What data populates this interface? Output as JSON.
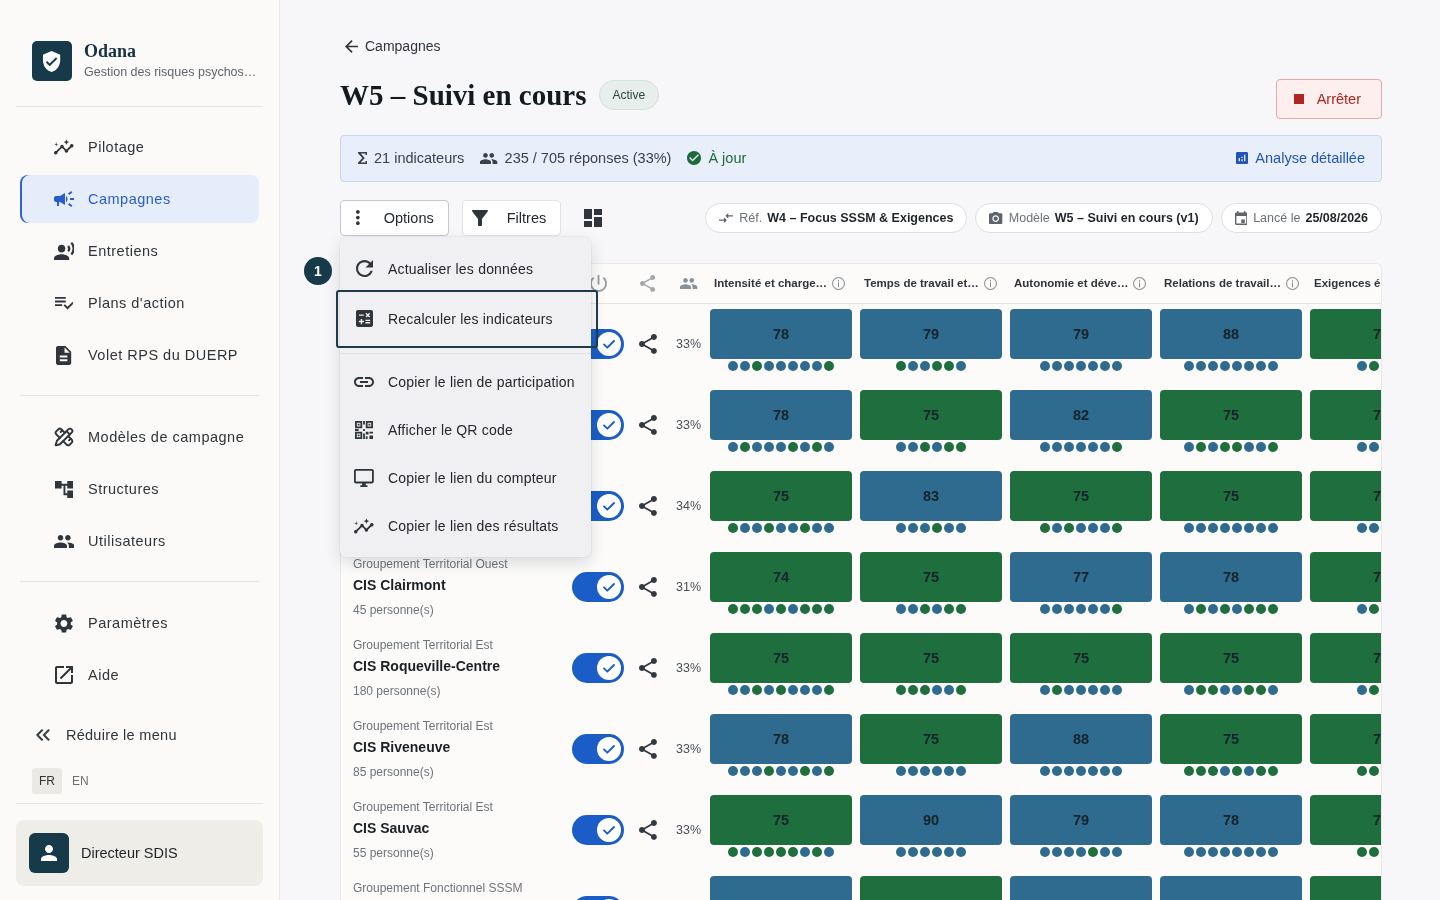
{
  "sidebar": {
    "brand": {
      "name": "Odana",
      "subtitle": "Gestion des risques psychos…"
    },
    "sections": [
      {
        "items": [
          {
            "label": "Pilotage",
            "selected": false
          },
          {
            "label": "Campagnes",
            "selected": true
          },
          {
            "label": "Entretiens",
            "selected": false
          },
          {
            "label": "Plans d'action",
            "selected": false
          },
          {
            "label": "Volet RPS du DUERP",
            "selected": false
          }
        ]
      },
      {
        "items": [
          {
            "label": "Modèles de campagne",
            "selected": false
          },
          {
            "label": "Structures",
            "selected": false
          },
          {
            "label": "Utilisateurs",
            "selected": false
          }
        ]
      },
      {
        "items": [
          {
            "label": "Paramètres",
            "selected": false
          },
          {
            "label": "Aide",
            "selected": false
          }
        ]
      }
    ],
    "collapse_label": "Réduire le menu",
    "languages": [
      {
        "label": "FR",
        "selected": true
      },
      {
        "label": "EN",
        "selected": false
      }
    ],
    "user": {
      "name": "Directeur SDIS"
    }
  },
  "breadcrumb": {
    "label": "Campagnes"
  },
  "header": {
    "title": "W5 – Suivi en cours",
    "status": "Active",
    "stop_label": "Arrêter"
  },
  "summary": {
    "indicators": "21 indicateurs",
    "responses": "235 / 705 réponses (33%)",
    "sync": "À jour",
    "analysis_link": "Analyse détaillée"
  },
  "toolbar": {
    "options": {
      "label": "Options",
      "expanded": true
    },
    "filters": {
      "label": "Filtres"
    },
    "chips": [
      {
        "label": "Réf.",
        "value": "W4 – Focus SSSM & Exigences"
      },
      {
        "label": "Modèle",
        "value": "W5 – Suivi en cours (v1)"
      },
      {
        "label": "Lancé le",
        "value": "25/08/2026"
      }
    ]
  },
  "options_menu": {
    "step_badge": "1",
    "groups": [
      {
        "items": [
          {
            "label": "Actualiser les données",
            "focused": false
          },
          {
            "label": "Recalculer les indicateurs",
            "focused": true
          }
        ]
      },
      {
        "items": [
          {
            "label": "Copier le lien de participation",
            "focused": false
          },
          {
            "label": "Afficher le QR code",
            "focused": false
          },
          {
            "label": "Copier le lien du compteur",
            "focused": false
          },
          {
            "label": "Copier le lien des résultats",
            "focused": false
          }
        ]
      }
    ]
  },
  "table": {
    "columns": [
      {
        "label": "Intensité et charge…"
      },
      {
        "label": "Temps de travail et…"
      },
      {
        "label": "Autonomie et déve…"
      },
      {
        "label": "Relations de travail…"
      },
      {
        "label": "Exigences é"
      }
    ],
    "rows": [
      {
        "enabled": true,
        "rate": "33%",
        "scores": [
          {
            "value": "78",
            "color": "#2e6b8e",
            "dots": [
              {
                "color": "#2e6b8e"
              },
              {
                "color": "#2e6b8e"
              },
              {
                "color": "#1f6e3e"
              },
              {
                "color": "#2e6b8e"
              },
              {
                "color": "#2e6b8e"
              },
              {
                "color": "#2e6b8e"
              },
              {
                "color": "#2e6b8e"
              },
              {
                "color": "#2e6b8e"
              },
              {
                "color": "#1f6e3e"
              }
            ]
          },
          {
            "value": "79",
            "color": "#2e6b8e",
            "dots": [
              {
                "color": "#1f6e3e"
              },
              {
                "color": "#2e6b8e"
              },
              {
                "color": "#2e6b8e"
              },
              {
                "color": "#1f6e3e"
              },
              {
                "color": "#1f6e3e"
              },
              {
                "color": "#2e6b8e"
              }
            ]
          },
          {
            "value": "79",
            "color": "#2e6b8e",
            "dots": [
              {
                "color": "#2e6b8e"
              },
              {
                "color": "#2e6b8e"
              },
              {
                "color": "#2e6b8e"
              },
              {
                "color": "#2e6b8e"
              },
              {
                "color": "#2e6b8e"
              },
              {
                "color": "#2e6b8e"
              },
              {
                "color": "#2e6b8e"
              }
            ]
          },
          {
            "value": "88",
            "color": "#2e6b8e",
            "dots": [
              {
                "color": "#2e6b8e"
              },
              {
                "color": "#2e6b8e"
              },
              {
                "color": "#2e6b8e"
              },
              {
                "color": "#2e6b8e"
              },
              {
                "color": "#2e6b8e"
              },
              {
                "color": "#2e6b8e"
              },
              {
                "color": "#2e6b8e"
              },
              {
                "color": "#2e6b8e"
              }
            ]
          },
          {
            "value": "7",
            "color": "#1f6e3e",
            "dots": [
              {
                "color": "#2e6b8e"
              },
              {
                "color": "#1f6e3e"
              }
            ]
          }
        ]
      },
      {
        "enabled": true,
        "rate": "33%",
        "scores": [
          {
            "value": "78",
            "color": "#2e6b8e",
            "dots": [
              {
                "color": "#2e6b8e"
              },
              {
                "color": "#1f6e3e"
              },
              {
                "color": "#2e6b8e"
              },
              {
                "color": "#2e6b8e"
              },
              {
                "color": "#2e6b8e"
              },
              {
                "color": "#1f6e3e"
              },
              {
                "color": "#2e6b8e"
              },
              {
                "color": "#1f6e3e"
              },
              {
                "color": "#2e6b8e"
              }
            ]
          },
          {
            "value": "75",
            "color": "#1f6e3e",
            "dots": [
              {
                "color": "#2e6b8e"
              },
              {
                "color": "#2e6b8e"
              },
              {
                "color": "#1f6e3e"
              },
              {
                "color": "#2e6b8e"
              },
              {
                "color": "#1f6e3e"
              },
              {
                "color": "#1f6e3e"
              }
            ]
          },
          {
            "value": "82",
            "color": "#2e6b8e",
            "dots": [
              {
                "color": "#2e6b8e"
              },
              {
                "color": "#2e6b8e"
              },
              {
                "color": "#2e6b8e"
              },
              {
                "color": "#2e6b8e"
              },
              {
                "color": "#2e6b8e"
              },
              {
                "color": "#2e6b8e"
              },
              {
                "color": "#1f6e3e"
              }
            ]
          },
          {
            "value": "75",
            "color": "#1f6e3e",
            "dots": [
              {
                "color": "#2e6b8e"
              },
              {
                "color": "#1f6e3e"
              },
              {
                "color": "#2e6b8e"
              },
              {
                "color": "#1f6e3e"
              },
              {
                "color": "#1f6e3e"
              },
              {
                "color": "#2e6b8e"
              },
              {
                "color": "#2e6b8e"
              },
              {
                "color": "#1f6e3e"
              }
            ]
          },
          {
            "value": "7",
            "color": "#1f6e3e",
            "dots": [
              {
                "color": "#2e6b8e"
              },
              {
                "color": "#2e6b8e"
              }
            ]
          }
        ]
      },
      {
        "enabled": true,
        "rate": "34%",
        "scores": [
          {
            "value": "75",
            "color": "#1f6e3e",
            "dots": [
              {
                "color": "#1f6e3e"
              },
              {
                "color": "#2e6b8e"
              },
              {
                "color": "#2e6b8e"
              },
              {
                "color": "#1f6e3e"
              },
              {
                "color": "#2e6b8e"
              },
              {
                "color": "#2e6b8e"
              },
              {
                "color": "#1f6e3e"
              },
              {
                "color": "#2e6b8e"
              },
              {
                "color": "#2e6b8e"
              }
            ]
          },
          {
            "value": "83",
            "color": "#2e6b8e",
            "dots": [
              {
                "color": "#2e6b8e"
              },
              {
                "color": "#2e6b8e"
              },
              {
                "color": "#2e6b8e"
              },
              {
                "color": "#1f6e3e"
              },
              {
                "color": "#2e6b8e"
              },
              {
                "color": "#2e6b8e"
              }
            ]
          },
          {
            "value": "75",
            "color": "#1f6e3e",
            "dots": [
              {
                "color": "#1f6e3e"
              },
              {
                "color": "#2e6b8e"
              },
              {
                "color": "#1f6e3e"
              },
              {
                "color": "#2e6b8e"
              },
              {
                "color": "#2e6b8e"
              },
              {
                "color": "#2e6b8e"
              },
              {
                "color": "#1f6e3e"
              }
            ]
          },
          {
            "value": "75",
            "color": "#1f6e3e",
            "dots": [
              {
                "color": "#2e6b8e"
              },
              {
                "color": "#2e6b8e"
              },
              {
                "color": "#2e6b8e"
              },
              {
                "color": "#2e6b8e"
              },
              {
                "color": "#2e6b8e"
              },
              {
                "color": "#2e6b8e"
              },
              {
                "color": "#2e6b8e"
              },
              {
                "color": "#2e6b8e"
              }
            ]
          },
          {
            "value": "7",
            "color": "#1f6e3e",
            "dots": [
              {
                "color": "#2e6b8e"
              },
              {
                "color": "#2e6b8e"
              }
            ]
          }
        ]
      },
      {
        "group": "Groupement Territorial Ouest",
        "name": "CIS Clairmont",
        "headcount": "45 personne(s)",
        "enabled": true,
        "rate": "31%",
        "scores": [
          {
            "value": "74",
            "color": "#1f6e3e",
            "dots": [
              {
                "color": "#1f6e3e"
              },
              {
                "color": "#1f6e3e"
              },
              {
                "color": "#1f6e3e"
              },
              {
                "color": "#2e6b8e"
              },
              {
                "color": "#1f6e3e"
              },
              {
                "color": "#2e6b8e"
              },
              {
                "color": "#1f6e3e"
              },
              {
                "color": "#1f6e3e"
              },
              {
                "color": "#1f6e3e"
              }
            ]
          },
          {
            "value": "75",
            "color": "#1f6e3e",
            "dots": [
              {
                "color": "#2e6b8e"
              },
              {
                "color": "#2e6b8e"
              },
              {
                "color": "#1f6e3e"
              },
              {
                "color": "#2e6b8e"
              },
              {
                "color": "#1f6e3e"
              },
              {
                "color": "#1f6e3e"
              }
            ]
          },
          {
            "value": "77",
            "color": "#2e6b8e",
            "dots": [
              {
                "color": "#2e6b8e"
              },
              {
                "color": "#2e6b8e"
              },
              {
                "color": "#2e6b8e"
              },
              {
                "color": "#2e6b8e"
              },
              {
                "color": "#2e6b8e"
              },
              {
                "color": "#2e6b8e"
              },
              {
                "color": "#1f6e3e"
              }
            ]
          },
          {
            "value": "78",
            "color": "#2e6b8e",
            "dots": [
              {
                "color": "#2e6b8e"
              },
              {
                "color": "#1f6e3e"
              },
              {
                "color": "#2e6b8e"
              },
              {
                "color": "#1f6e3e"
              },
              {
                "color": "#2e6b8e"
              },
              {
                "color": "#1f6e3e"
              },
              {
                "color": "#1f6e3e"
              },
              {
                "color": "#1f6e3e"
              }
            ]
          },
          {
            "value": "7",
            "color": "#1f6e3e",
            "dots": [
              {
                "color": "#2e6b8e"
              },
              {
                "color": "#1f6e3e"
              }
            ]
          }
        ]
      },
      {
        "group": "Groupement Territorial Est",
        "name": "CIS Roqueville-Centre",
        "headcount": "180 personne(s)",
        "enabled": true,
        "rate": "33%",
        "scores": [
          {
            "value": "75",
            "color": "#1f6e3e",
            "dots": [
              {
                "color": "#2e6b8e"
              },
              {
                "color": "#2e6b8e"
              },
              {
                "color": "#1f6e3e"
              },
              {
                "color": "#2e6b8e"
              },
              {
                "color": "#1f6e3e"
              },
              {
                "color": "#2e6b8e"
              },
              {
                "color": "#2e6b8e"
              },
              {
                "color": "#2e6b8e"
              },
              {
                "color": "#1f6e3e"
              }
            ]
          },
          {
            "value": "75",
            "color": "#1f6e3e",
            "dots": [
              {
                "color": "#1f6e3e"
              },
              {
                "color": "#1f6e3e"
              },
              {
                "color": "#1f6e3e"
              },
              {
                "color": "#2e6b8e"
              },
              {
                "color": "#2e6b8e"
              },
              {
                "color": "#1f6e3e"
              }
            ]
          },
          {
            "value": "75",
            "color": "#1f6e3e",
            "dots": [
              {
                "color": "#2e6b8e"
              },
              {
                "color": "#1f6e3e"
              },
              {
                "color": "#2e6b8e"
              },
              {
                "color": "#2e6b8e"
              },
              {
                "color": "#2e6b8e"
              },
              {
                "color": "#2e6b8e"
              },
              {
                "color": "#2e6b8e"
              }
            ]
          },
          {
            "value": "75",
            "color": "#1f6e3e",
            "dots": [
              {
                "color": "#2e6b8e"
              },
              {
                "color": "#1f6e3e"
              },
              {
                "color": "#1f6e3e"
              },
              {
                "color": "#2e6b8e"
              },
              {
                "color": "#2e6b8e"
              },
              {
                "color": "#1f6e3e"
              },
              {
                "color": "#1f6e3e"
              },
              {
                "color": "#2e6b8e"
              }
            ]
          },
          {
            "value": "7",
            "color": "#1f6e3e",
            "dots": [
              {
                "color": "#2e6b8e"
              },
              {
                "color": "#1f6e3e"
              }
            ]
          }
        ]
      },
      {
        "group": "Groupement Territorial Est",
        "name": "CIS Riveneuve",
        "headcount": "85 personne(s)",
        "enabled": true,
        "rate": "33%",
        "scores": [
          {
            "value": "78",
            "color": "#2e6b8e",
            "dots": [
              {
                "color": "#2e6b8e"
              },
              {
                "color": "#2e6b8e"
              },
              {
                "color": "#2e6b8e"
              },
              {
                "color": "#1f6e3e"
              },
              {
                "color": "#2e6b8e"
              },
              {
                "color": "#2e6b8e"
              },
              {
                "color": "#1f6e3e"
              },
              {
                "color": "#2e6b8e"
              },
              {
                "color": "#1f6e3e"
              }
            ]
          },
          {
            "value": "75",
            "color": "#1f6e3e",
            "dots": [
              {
                "color": "#2e6b8e"
              },
              {
                "color": "#2e6b8e"
              },
              {
                "color": "#2e6b8e"
              },
              {
                "color": "#2e6b8e"
              },
              {
                "color": "#2e6b8e"
              },
              {
                "color": "#2e6b8e"
              }
            ]
          },
          {
            "value": "88",
            "color": "#2e6b8e",
            "dots": [
              {
                "color": "#2e6b8e"
              },
              {
                "color": "#2e6b8e"
              },
              {
                "color": "#2e6b8e"
              },
              {
                "color": "#2e6b8e"
              },
              {
                "color": "#2e6b8e"
              },
              {
                "color": "#2e6b8e"
              },
              {
                "color": "#2e6b8e"
              }
            ]
          },
          {
            "value": "75",
            "color": "#1f6e3e",
            "dots": [
              {
                "color": "#1f6e3e"
              },
              {
                "color": "#1f6e3e"
              },
              {
                "color": "#1f6e3e"
              },
              {
                "color": "#2e6b8e"
              },
              {
                "color": "#1f6e3e"
              },
              {
                "color": "#2e6b8e"
              },
              {
                "color": "#1f6e3e"
              },
              {
                "color": "#1f6e3e"
              }
            ]
          },
          {
            "value": "7",
            "color": "#1f6e3e",
            "dots": [
              {
                "color": "#1f6e3e"
              },
              {
                "color": "#1f6e3e"
              }
            ]
          }
        ]
      },
      {
        "group": "Groupement Territorial Est",
        "name": "CIS Sauvac",
        "headcount": "55 personne(s)",
        "enabled": true,
        "rate": "33%",
        "scores": [
          {
            "value": "75",
            "color": "#1f6e3e",
            "dots": [
              {
                "color": "#1f6e3e"
              },
              {
                "color": "#2e6b8e"
              },
              {
                "color": "#1f6e3e"
              },
              {
                "color": "#1f6e3e"
              },
              {
                "color": "#1f6e3e"
              },
              {
                "color": "#1f6e3e"
              },
              {
                "color": "#2e6b8e"
              },
              {
                "color": "#1f6e3e"
              },
              {
                "color": "#2e6b8e"
              }
            ]
          },
          {
            "value": "90",
            "color": "#2e6b8e",
            "dots": [
              {
                "color": "#2e6b8e"
              },
              {
                "color": "#2e6b8e"
              },
              {
                "color": "#2e6b8e"
              },
              {
                "color": "#2e6b8e"
              },
              {
                "color": "#2e6b8e"
              },
              {
                "color": "#2e6b8e"
              }
            ]
          },
          {
            "value": "79",
            "color": "#2e6b8e",
            "dots": [
              {
                "color": "#2e6b8e"
              },
              {
                "color": "#2e6b8e"
              },
              {
                "color": "#2e6b8e"
              },
              {
                "color": "#2e6b8e"
              },
              {
                "color": "#1f6e3e"
              },
              {
                "color": "#2e6b8e"
              },
              {
                "color": "#2e6b8e"
              }
            ]
          },
          {
            "value": "78",
            "color": "#2e6b8e",
            "dots": [
              {
                "color": "#2e6b8e"
              },
              {
                "color": "#2e6b8e"
              },
              {
                "color": "#2e6b8e"
              },
              {
                "color": "#2e6b8e"
              },
              {
                "color": "#2e6b8e"
              },
              {
                "color": "#2e6b8e"
              },
              {
                "color": "#2e6b8e"
              },
              {
                "color": "#2e6b8e"
              }
            ]
          },
          {
            "value": "7",
            "color": "#1f6e3e",
            "dots": [
              {
                "color": "#1f6e3e"
              },
              {
                "color": "#1f6e3e"
              }
            ]
          }
        ]
      },
      {
        "group": "Groupement Fonctionnel SSSM",
        "enabled": true,
        "scores": [
          {
            "color": "#2e6b8e"
          },
          {
            "color": "#1f6e3e"
          },
          {
            "color": "#2e6b8e"
          },
          {
            "color": "#2e6b8e"
          },
          {
            "color": "#1f6e3e"
          }
        ]
      }
    ]
  }
}
